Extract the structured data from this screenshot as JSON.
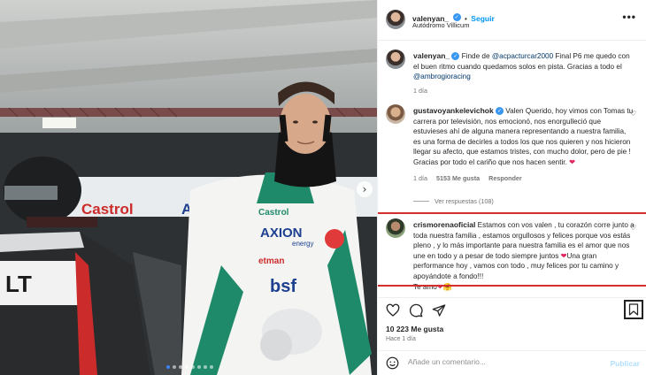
{
  "post": {
    "author": "valenyan_",
    "follow_label": "Seguir",
    "location": "Autódromo Villicum",
    "more_label": "•••",
    "caption": {
      "username": "valenyan_",
      "text_1": " Finde de ",
      "mention_1": "@acpacturcar2000",
      "text_2": " Final P6 me quedo con el buen ritmo cuando quedamos solos en pista. Gracias a todo el ",
      "mention_2": "@ambrogioracing",
      "time": "1 día"
    }
  },
  "comments": [
    {
      "username": "gustavoyankelevichok",
      "text": " Valen Querido, hoy vimos con Tomas tu carrera por televisión, nos emocionó, nos enorgulleció que estuvieses ahí de alguna manera representando a nuestra familia, es una forma de decirles a todos los que nos quieren y nos hicieron llegar su afecto, que estamos tristes, con mucho dolor, pero de pie ! Gracias por todo el cariño que nos hacen sentir. ",
      "emoji": "❤",
      "time": "1 día",
      "likes": "5153 Me gusta",
      "reply_label": "Responder",
      "view_replies": "Ver respuestas (108)"
    },
    {
      "username": "crismorenaoficial",
      "text": " Estamos con vos valen , tu corazón corre junto a toda nuestra familia , estamos orgullosos y felices porque vos estás pleno , y lo más importante para nuestra familia es el amor que nos une en todo y a pesar de todo siempre juntos ",
      "emoji_1": "❤",
      "text_2": "Una gran performance hoy , vamos con todo , muy felices por tu camino y apoyándote a fondo!!!",
      "text_3": "Te amo",
      "emoji_2": "❤",
      "emoji_3": "🤗"
    }
  ],
  "actions": {
    "likes": "10 223 Me gusta",
    "time_ago": "Hace 1 día"
  },
  "add_comment": {
    "placeholder": "Añade un comentario...",
    "publish_label": "Publicar"
  },
  "photo": {
    "sponsor_1": "Castrol",
    "sponsor_2": "AXION",
    "sponsor_2_sub": "energy",
    "sponsor_3": "etman",
    "sponsor_4": "bsf",
    "bg_brand": "Castrol",
    "bg_brand_2": "AX"
  },
  "colors": {
    "accent_blue": "#0095f6",
    "verified_blue": "#3897f0",
    "highlight_red": "#d32f2f",
    "heart_red": "#e0245e",
    "suit_green": "#1f8a6a"
  }
}
